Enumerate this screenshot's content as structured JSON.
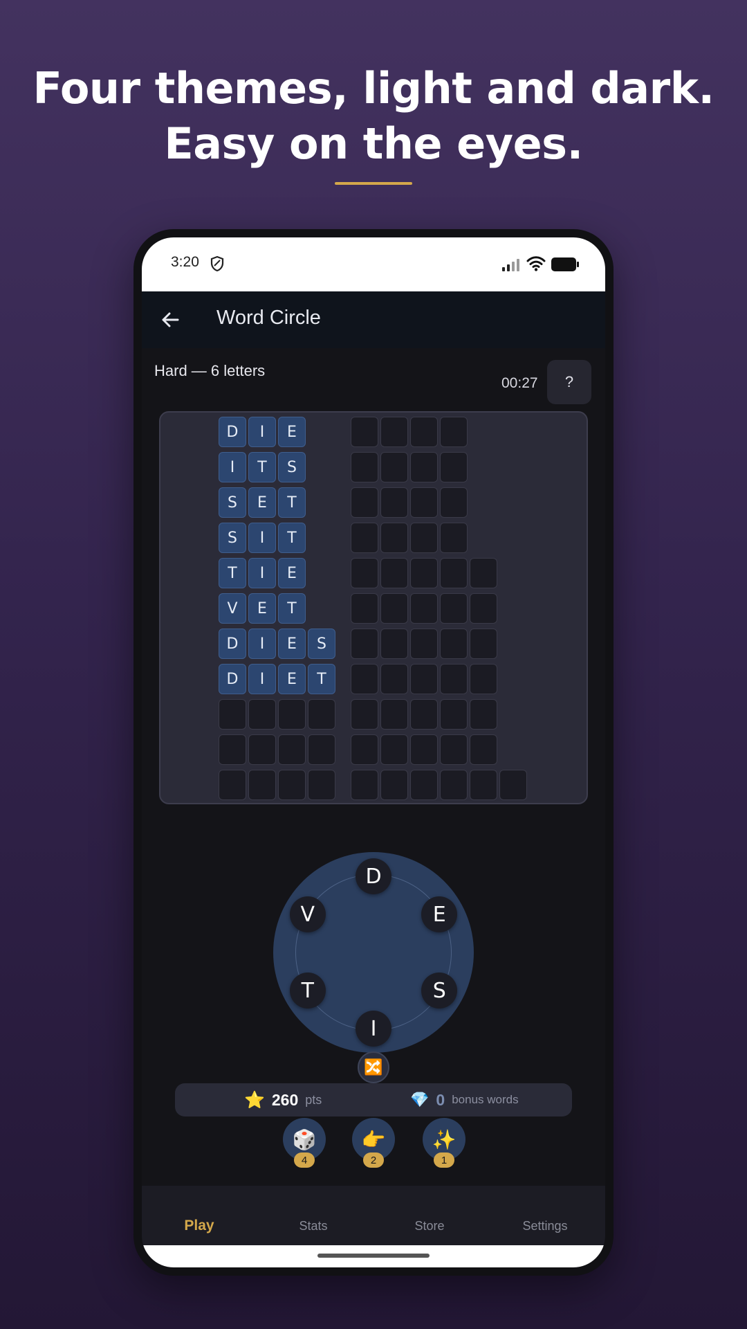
{
  "headline": {
    "line1": "Four themes, light and dark.",
    "line2": "Easy on the eyes."
  },
  "status_bar": {
    "time": "3:20",
    "icons": [
      "shield-icon",
      "signal-icon",
      "wifi-icon",
      "battery-icon"
    ]
  },
  "app_bar": {
    "title": "Word Circle",
    "back_icon": "arrow-left-icon"
  },
  "game": {
    "level_label": "Hard — 6 letters",
    "timer": "00:27",
    "help_label": "?",
    "found_words": [
      "DIE",
      "ITS",
      "SET",
      "SIT",
      "TIE",
      "VET",
      "DIES",
      "DIET"
    ],
    "left_column_lengths": [
      3,
      3,
      3,
      3,
      3,
      3,
      4,
      4,
      4,
      4,
      4
    ],
    "right_column_lengths": [
      4,
      4,
      4,
      4,
      5,
      5,
      5,
      5,
      5,
      5,
      6
    ],
    "wheel_letters": [
      "D",
      "E",
      "S",
      "I",
      "T",
      "V"
    ],
    "shuffle_icon": "🔀"
  },
  "score": {
    "star_icon": "⭐",
    "points": "260",
    "points_unit": "pts",
    "gem_icon": "💎",
    "bonus": "0",
    "bonus_unit": "bonus words"
  },
  "powerups": [
    {
      "icon": "🎲",
      "count": "4"
    },
    {
      "icon": "👉",
      "count": "2"
    },
    {
      "icon": "✨",
      "count": "1"
    }
  ],
  "nav": {
    "items": [
      {
        "label": "Play",
        "active": true
      },
      {
        "label": "Stats",
        "active": false
      },
      {
        "label": "Store",
        "active": false
      },
      {
        "label": "Settings",
        "active": false
      }
    ]
  },
  "colors": {
    "accent": "#d4a84b",
    "tile_filled": "#2c4670",
    "wheel": "#2b3e5e",
    "board": "#2b2b38"
  }
}
